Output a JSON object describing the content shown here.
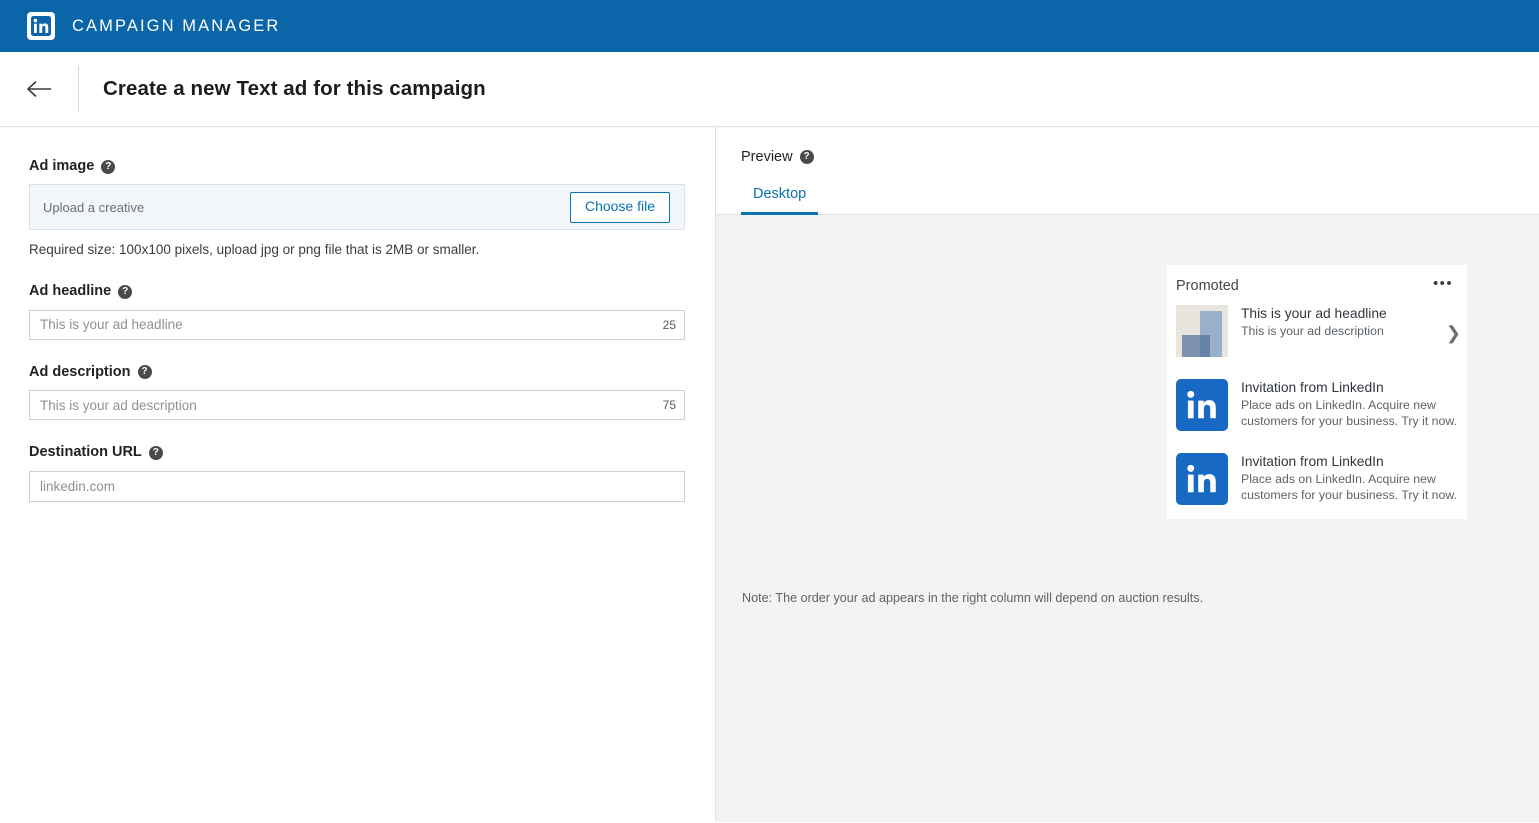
{
  "brand": {
    "name": "CAMPAIGN MANAGER",
    "logo_icon": "linkedin-logo-icon",
    "bar_color": "#0a66a8"
  },
  "header": {
    "back_icon": "arrow-left-icon",
    "title": "Create a new Text ad for this campaign"
  },
  "form": {
    "ad_image": {
      "label": "Ad image",
      "help_icon": "?",
      "upload_placeholder": "Upload a creative",
      "choose_file_label": "Choose file",
      "helper_text": "Required size: 100x100 pixels, upload jpg or png file that is 2MB or smaller."
    },
    "ad_headline": {
      "label": "Ad headline",
      "help_icon": "?",
      "placeholder": "This is your ad headline",
      "value": "",
      "char_count": "25"
    },
    "ad_description": {
      "label": "Ad description",
      "help_icon": "?",
      "placeholder": "This is your ad description",
      "value": "",
      "char_count": "75"
    },
    "destination_url": {
      "label": "Destination URL",
      "help_icon": "?",
      "placeholder": "linkedin.com",
      "value": ""
    }
  },
  "preview": {
    "title": "Preview",
    "help_icon": "?",
    "tabs": [
      {
        "label": "Desktop",
        "active": true
      }
    ],
    "card": {
      "promoted_label": "Promoted",
      "kebab_icon": "more-options-icon",
      "chevron_icon": "chevron-right-icon",
      "ads": [
        {
          "thumb_type": "placeholder-image",
          "headline": "This is your ad headline",
          "description": "This is your ad description"
        },
        {
          "thumb_type": "linkedin-logo-icon",
          "headline": "Invitation from LinkedIn",
          "description": "Place ads on LinkedIn. Acquire new customers for your business. Try it now."
        },
        {
          "thumb_type": "linkedin-logo-icon",
          "headline": "Invitation from LinkedIn",
          "description": "Place ads on LinkedIn. Acquire new customers for your business. Try it now."
        }
      ]
    },
    "note": "Note: The order your ad appears in the right column will depend on auction results."
  }
}
